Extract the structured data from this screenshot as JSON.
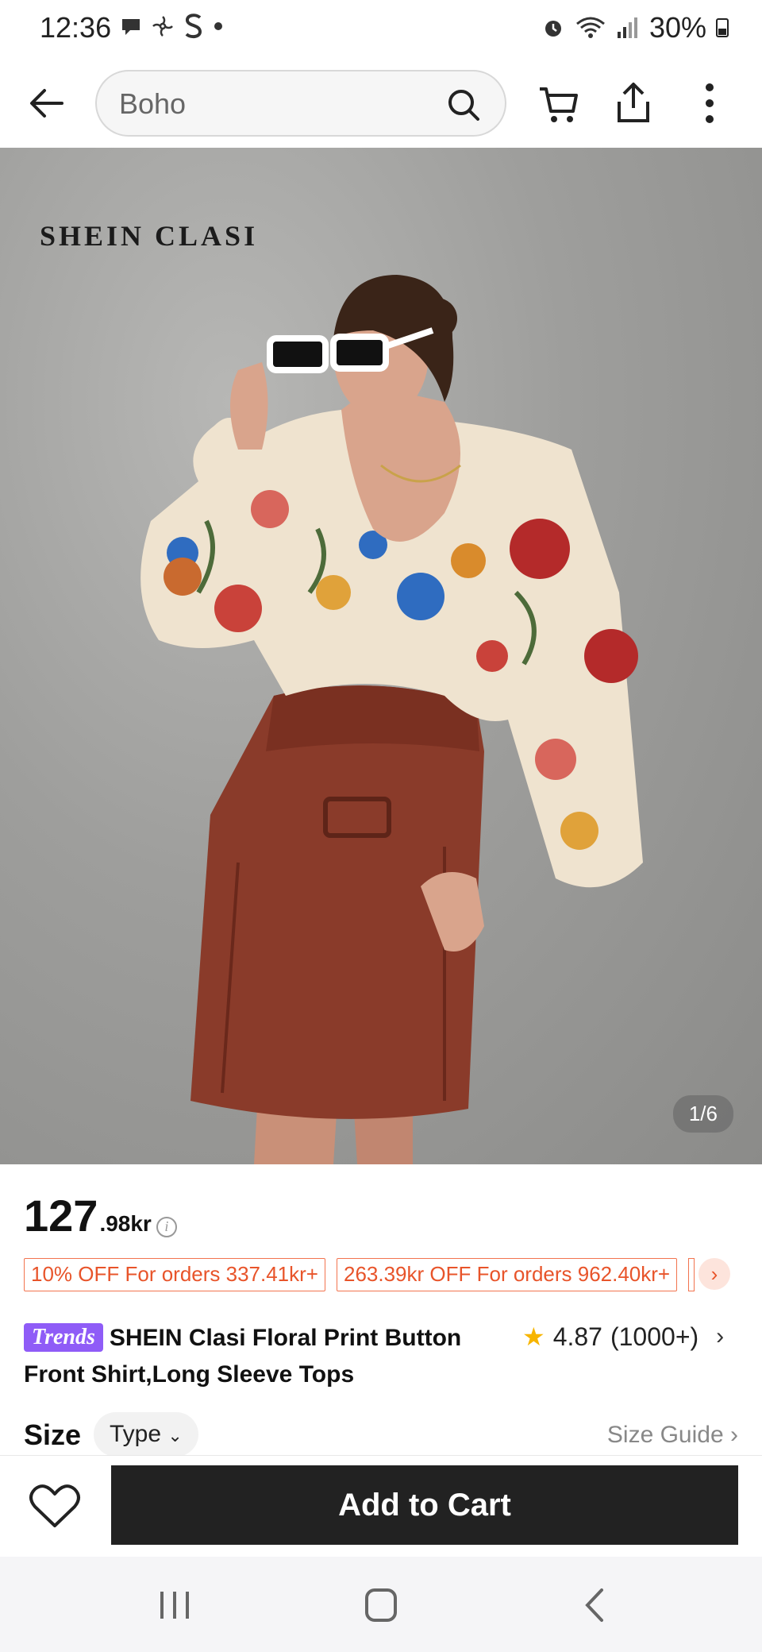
{
  "status_bar": {
    "time": "12:36",
    "battery": "30%",
    "icons": [
      "chat-icon",
      "pinwheel-icon",
      "s-app-icon",
      "dot-icon",
      "alarm-icon",
      "wifi-icon",
      "signal-icon",
      "battery-icon"
    ]
  },
  "top_bar": {
    "search_value": "Boho",
    "icons": [
      "back-arrow-icon",
      "search-icon",
      "cart-icon",
      "share-icon",
      "more-vertical-icon"
    ]
  },
  "gallery": {
    "brand_watermark": "SHEIN CLASI",
    "counter": "1/6",
    "colors": {
      "wall": "#9e9e9c",
      "skirt": "#8a3b2a",
      "blouse": "#efe3cf"
    }
  },
  "price": {
    "integer": "127",
    "decimal": ".98kr",
    "info_glyph": "i"
  },
  "coupons": [
    "10% OFF For orders 337.41kr+",
    "263.39kr OFF For orders 962.40kr+"
  ],
  "product": {
    "badge": "Trends",
    "title": "SHEIN Clasi Floral Print Button Front Shirt,Long Sleeve Tops",
    "rating_value": "4.87",
    "rating_count": "(1000+)"
  },
  "size": {
    "label": "Size",
    "type_selector": "Type",
    "guide_label": "Size Guide"
  },
  "actions": {
    "add_to_cart": "Add to Cart"
  },
  "colors": {
    "accent": "#e8542a",
    "coupon_border": "#f2744f",
    "trends_badge": "#8f5cf7",
    "cart_button": "#222222",
    "star": "#f7b500"
  }
}
